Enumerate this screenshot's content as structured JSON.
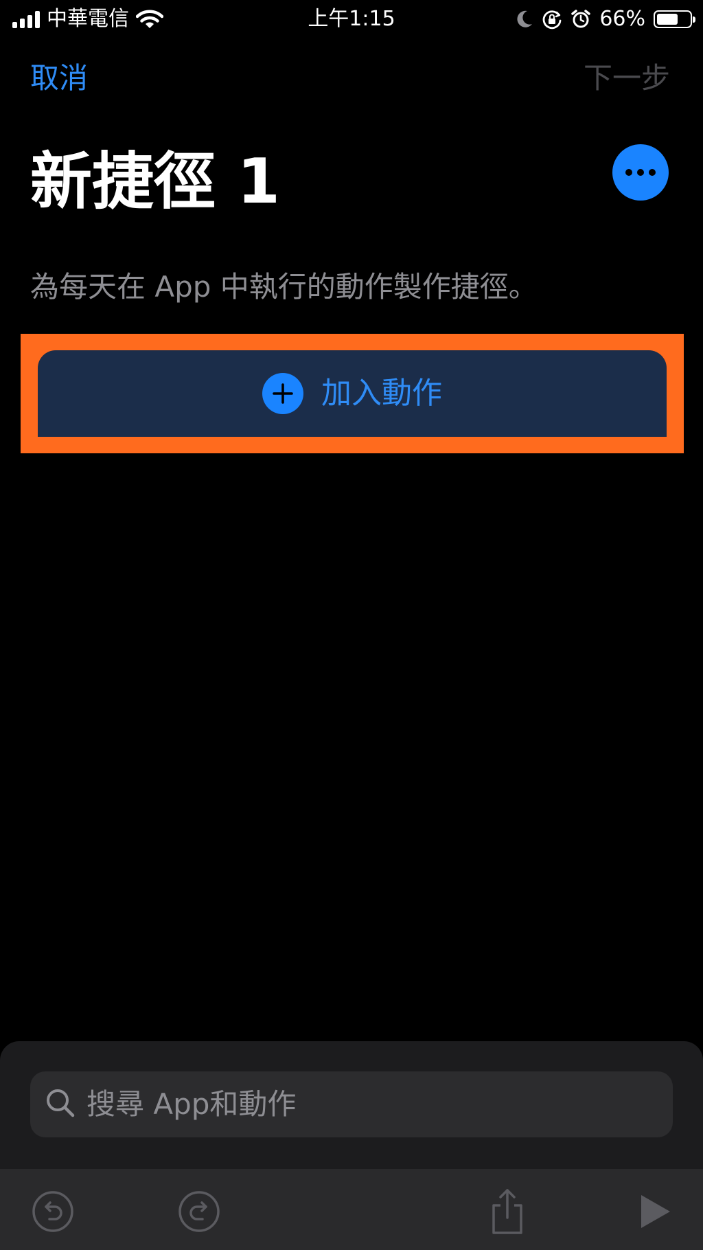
{
  "status_bar": {
    "carrier": "中華電信",
    "time": "上午1:15",
    "battery_percent": "66%",
    "battery_level": 0.66,
    "icons": [
      "signal-icon",
      "wifi-icon",
      "moon-icon",
      "orientation-lock-icon",
      "alarm-icon",
      "battery-icon"
    ]
  },
  "nav": {
    "cancel_label": "取消",
    "next_label": "下一步"
  },
  "header": {
    "title": "新捷徑 1",
    "more_icon": "ellipsis-icon"
  },
  "main": {
    "description": "為每天在 App 中執行的動作製作捷徑。",
    "add_action_label": "加入動作"
  },
  "search": {
    "placeholder": "搜尋 App和動作"
  },
  "toolbar": {
    "icons": [
      "undo-icon",
      "redo-icon",
      "share-icon",
      "play-icon"
    ]
  },
  "colors": {
    "accent": "#1a84ff",
    "link": "#2f8cf6",
    "highlight": "#ff6b1e",
    "button_bg": "#1b2d4a",
    "secondary_text": "#8e8e93"
  }
}
